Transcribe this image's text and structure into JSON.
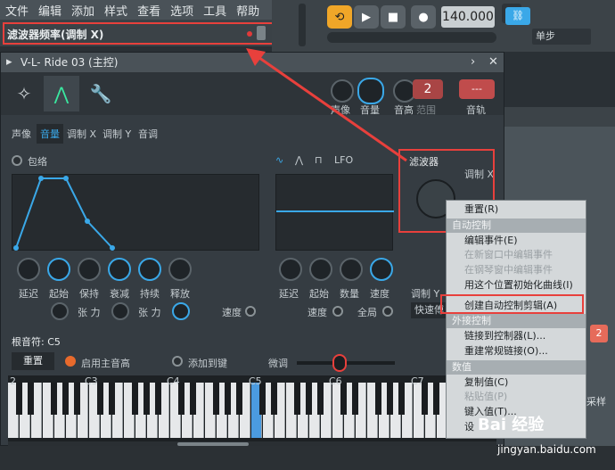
{
  "menu": [
    "文件",
    "编辑",
    "添加",
    "样式",
    "查看",
    "选项",
    "工具",
    "帮助"
  ],
  "hint": {
    "text": "滤波器频率(调制 X)"
  },
  "transport": {
    "tempo": "140.000",
    "pattern_select": "单步"
  },
  "plugin": {
    "title": "V-L- Ride 03 (主控)",
    "top_knobs": [
      {
        "label": "声像"
      },
      {
        "label": "音量"
      },
      {
        "label": "音高"
      },
      {
        "label": "范围",
        "value": "2"
      },
      {
        "label": "音轨",
        "value": "---"
      }
    ],
    "subtabs": [
      "声像",
      "音量",
      "调制 X",
      "调制 Y",
      "音调"
    ],
    "envelope": {
      "label": "包络",
      "knobs": [
        "延迟",
        "起始",
        "保持",
        "衰减",
        "持续",
        "释放"
      ],
      "tension": [
        "张 力",
        "张 力"
      ],
      "speed": "速度"
    },
    "lfo": {
      "label": "LFO",
      "knobs": [
        "延迟",
        "起始",
        "数量",
        "速度"
      ],
      "speed": "速度",
      "global": "全局"
    },
    "filter": {
      "label": "滤波器",
      "modx": "调制 X",
      "mody": "调制 Y",
      "fast": "快速傅"
    },
    "root_note": "根音符: C5",
    "reset_btn": "重置",
    "main_pitch": "启用主音高",
    "add_key": "添加到键",
    "finetune": "微调",
    "octaves": [
      "2",
      "C3",
      "C4",
      "C5",
      "C6",
      "C7"
    ]
  },
  "context_menu": {
    "items": [
      {
        "type": "item",
        "label": "重置(R)"
      },
      {
        "type": "header",
        "label": "自动控制"
      },
      {
        "type": "item",
        "label": "编辑事件(E)"
      },
      {
        "type": "item",
        "label": "在新窗口中编辑事件",
        "disabled": true
      },
      {
        "type": "item",
        "label": "在钢琴窗中编辑事件",
        "disabled": true
      },
      {
        "type": "item",
        "label": "用这个位置初始化曲线(I)"
      },
      {
        "type": "item",
        "label": "创建自动控制剪辑(A)"
      },
      {
        "type": "header",
        "label": "外接控制"
      },
      {
        "type": "item",
        "label": "链接到控制器(L)..."
      },
      {
        "type": "item",
        "label": "重建常规链接(O)..."
      },
      {
        "type": "header",
        "label": "数值"
      },
      {
        "type": "item",
        "label": "复制值(C)"
      },
      {
        "type": "item",
        "label": "粘贴值(P)",
        "disabled": true
      },
      {
        "type": "item",
        "label": "键入值(T)..."
      },
      {
        "type": "item",
        "label": "设"
      }
    ]
  },
  "right_panel": {
    "small_value": "2",
    "sample": "采样"
  },
  "watermark": {
    "brand": "Bai 经验",
    "url": "jingyan.baidu.com"
  }
}
